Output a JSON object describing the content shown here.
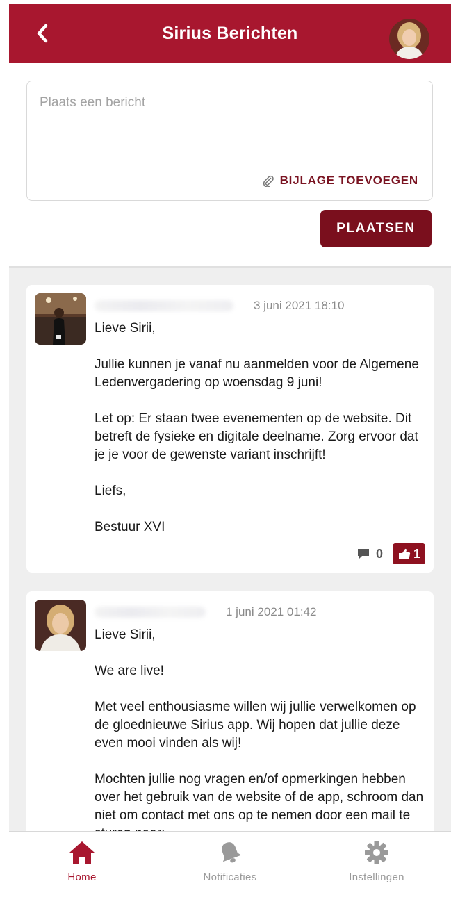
{
  "header": {
    "title": "Sirius Berichten",
    "back_icon": "chevron-left-icon",
    "avatar": "user-avatar",
    "color": "#a8172f"
  },
  "composer": {
    "placeholder": "Plaats een bericht",
    "attach_label": "BIJLAGE TOEVOEGEN",
    "attach_icon": "paperclip-icon",
    "submit_label": "PLAATSEN",
    "submit_color": "#7a0f1d"
  },
  "posts": [
    {
      "date": "3 juni 2021 18:10",
      "paragraphs": [
        "Lieve Sirii,",
        "Jullie kunnen je vanaf nu aanmelden voor de Algemene Ledenvergadering op woensdag 9 juni!",
        "Let op: Er staan twee evenementen op de website. Dit betreft de fysieke en digitale deelname. Zorg ervoor dat je je voor de gewenste variant inschrijft!",
        "Liefs,",
        "Bestuur XVI"
      ],
      "comments": "0",
      "likes": "1"
    },
    {
      "date": "1 juni 2021 01:42",
      "paragraphs": [
        "Lieve Sirii,",
        "We are live!",
        "Met veel enthousiasme willen wij jullie verwelkomen op de gloednieuwe Sirius app. Wij hopen dat jullie deze even mooi vinden als wij!",
        "Mochten jullie nog vragen en/of opmerkingen hebben over het gebruik van de website of de app, schroom dan niet om contact met ons op te nemen door een mail te sturen naar:"
      ]
    }
  ],
  "tabs": [
    {
      "label": "Home",
      "icon": "home-icon",
      "active": true
    },
    {
      "label": "Notificaties",
      "icon": "bell-icon",
      "active": false
    },
    {
      "label": "Instellingen",
      "icon": "gear-icon",
      "active": false
    }
  ],
  "colors": {
    "accent": "#a8172f",
    "like_badge": "#8e1120",
    "feed_background": "#efefef"
  }
}
